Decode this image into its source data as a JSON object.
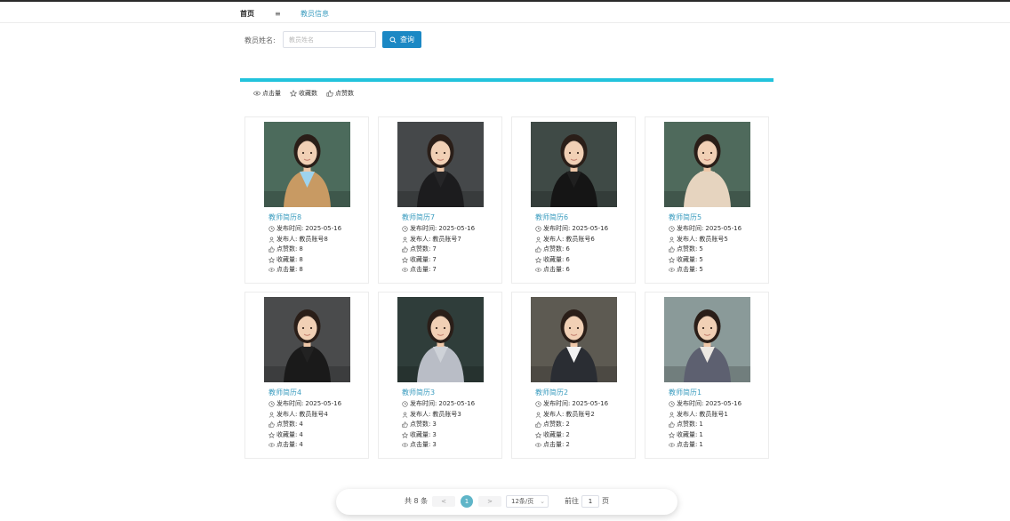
{
  "breadcrumb": {
    "home": "首页",
    "separator": "≡",
    "current": "教员信息"
  },
  "search": {
    "label": "教员姓名:",
    "placeholder": "教员姓名",
    "value": "",
    "button": "查询"
  },
  "sort": {
    "clicks": "点击量",
    "favorites": "收藏数",
    "likes": "点赞数"
  },
  "card_labels": {
    "publish_time": "发布时间:",
    "publisher": "发布人:",
    "likes": "点赞数:",
    "favorites": "收藏量:",
    "clicks": "点击量:"
  },
  "cards": [
    {
      "title": "教师简历8",
      "date": "2025-05-16",
      "publisher": "教员账号8",
      "likes": "8",
      "favorites": "8",
      "clicks": "8",
      "bg": "#4c6b5c",
      "suit": "#c89a63",
      "shirt": "#9ed3ee"
    },
    {
      "title": "教师简历7",
      "date": "2025-05-16",
      "publisher": "教员账号7",
      "likes": "7",
      "favorites": "7",
      "clicks": "7",
      "bg": "#45484a",
      "suit": "#1c1c1e",
      "shirt": "#262628"
    },
    {
      "title": "教师简历6",
      "date": "2025-05-16",
      "publisher": "教员账号6",
      "likes": "6",
      "favorites": "6",
      "clicks": "6",
      "bg": "#3f4a46",
      "suit": "#151515",
      "shirt": "#202020"
    },
    {
      "title": "教师简历5",
      "date": "2025-05-16",
      "publisher": "教员账号5",
      "likes": "5",
      "favorites": "5",
      "clicks": "5",
      "bg": "#4f6a5c",
      "suit": "#e6d4bf",
      "shirt": "#e6d4bf"
    },
    {
      "title": "教师简历4",
      "date": "2025-05-16",
      "publisher": "教员账号4",
      "likes": "4",
      "favorites": "4",
      "clicks": "4",
      "bg": "#4a4b4c",
      "suit": "#1a1a1a",
      "shirt": "#222222"
    },
    {
      "title": "教师简历3",
      "date": "2025-05-16",
      "publisher": "教员账号3",
      "likes": "3",
      "favorites": "3",
      "clicks": "3",
      "bg": "#2f3d3a",
      "suit": "#b9bdc6",
      "shirt": "#ced2d8"
    },
    {
      "title": "教师简历2",
      "date": "2025-05-16",
      "publisher": "教员账号2",
      "likes": "2",
      "favorites": "2",
      "clicks": "2",
      "bg": "#5d5a52",
      "suit": "#2a2d33",
      "shirt": "#f2f2f2"
    },
    {
      "title": "教师简历1",
      "date": "2025-05-16",
      "publisher": "教员账号1",
      "likes": "1",
      "favorites": "1",
      "clicks": "1",
      "bg": "#8a9a99",
      "suit": "#5d6070",
      "shirt": "#ece8e2"
    }
  ],
  "pagination": {
    "total": "共 8 条",
    "prev": "<",
    "current": "1",
    "next": ">",
    "page_size": "12条/页",
    "goto": "前往",
    "jump_value": "1",
    "page_suffix": "页"
  }
}
